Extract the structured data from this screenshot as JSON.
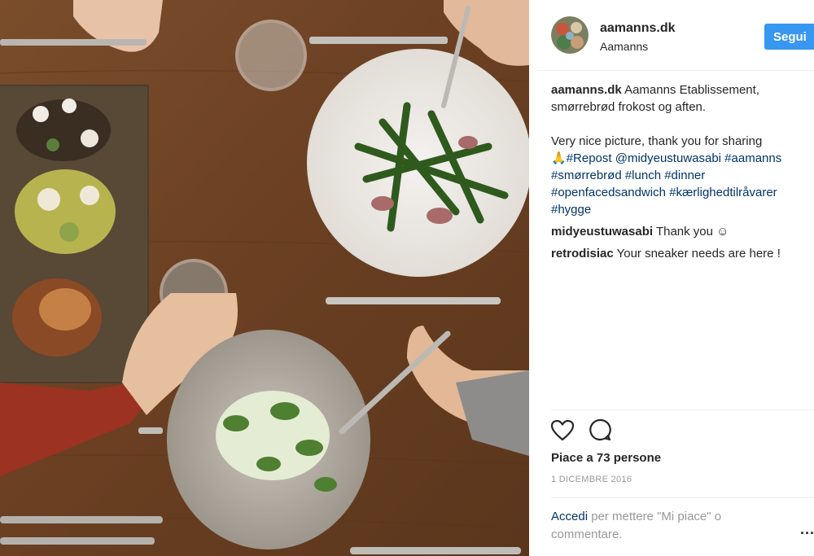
{
  "post": {
    "image_alt": "Overhead photo of a dining table with smørrebrød and plates of food",
    "header": {
      "username": "aamanns.dk",
      "full_name": "Aamanns",
      "follow_label": "Segui"
    },
    "caption": {
      "username": "aamanns.dk",
      "line1": "Aamanns Etablissement,",
      "line2": "smørrebrød frokost og aften.",
      "line3": "Very nice picture, thank you for sharing",
      "emoji": "🙏",
      "line4_tags": "#Repost @midyeustuwasabi #aamanns",
      "line5_tags": "#smørrebrød #lunch #dinner",
      "line6_tags": "#openfacedsandwich #kærlighedtilråvarer",
      "line7_tags": "#hygge"
    },
    "comments": [
      {
        "username": "midyeustuwasabi",
        "text": "Thank you ☺"
      },
      {
        "username": "retrodisiac",
        "text": "Your sneaker needs are here !"
      }
    ],
    "likes_text": "Piace a 73 persone",
    "date": "1 DICEMBRE 2016",
    "login": {
      "link": "Accedi",
      "text": "per mettere \"Mi piace\" o commentare."
    },
    "more_label": "..."
  },
  "icons": {
    "like": "heart-icon",
    "comment": "comment-icon",
    "more": "more-options-icon"
  },
  "colors": {
    "accent": "#3897f0",
    "link": "#003569",
    "muted": "#999999"
  }
}
